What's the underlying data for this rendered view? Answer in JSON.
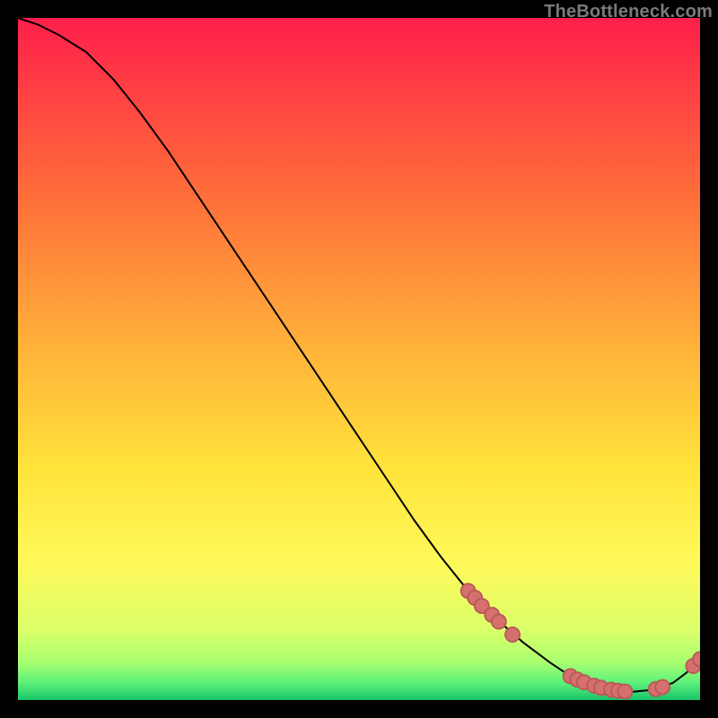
{
  "watermark": "TheBottleneck.com",
  "colors": {
    "frame": "#000000",
    "curve": "#000000",
    "marker_fill": "#d6706e",
    "marker_stroke": "#b85a57",
    "gradient_stops": [
      {
        "offset": 0.0,
        "color": "#ff1f4b"
      },
      {
        "offset": 0.25,
        "color": "#ff6b3a"
      },
      {
        "offset": 0.48,
        "color": "#ffb13a"
      },
      {
        "offset": 0.66,
        "color": "#ffe33a"
      },
      {
        "offset": 0.8,
        "color": "#fff95a"
      },
      {
        "offset": 0.9,
        "color": "#d9ff6a"
      },
      {
        "offset": 0.945,
        "color": "#a8ff70"
      },
      {
        "offset": 0.975,
        "color": "#5cf07a"
      },
      {
        "offset": 1.0,
        "color": "#17c46a"
      }
    ]
  },
  "chart_data": {
    "type": "line",
    "title": "",
    "xlabel": "",
    "ylabel": "",
    "xlim": [
      0,
      100
    ],
    "ylim": [
      0,
      100
    ],
    "series": [
      {
        "name": "curve",
        "x": [
          0,
          3,
          6,
          10,
          14,
          18,
          22,
          26,
          30,
          34,
          38,
          42,
          46,
          50,
          54,
          58,
          62,
          66,
          70,
          74,
          78,
          81,
          84,
          87,
          90,
          93,
          96,
          98,
          100
        ],
        "y": [
          100,
          99,
          97.5,
          95,
          91,
          86,
          80.5,
          74.5,
          68.5,
          62.5,
          56.5,
          50.5,
          44.5,
          38.5,
          32.5,
          26.5,
          21,
          16,
          12,
          8.5,
          5.5,
          3.5,
          2.2,
          1.5,
          1.2,
          1.5,
          2.5,
          4,
          6
        ]
      }
    ],
    "markers": [
      {
        "x": 66,
        "y": 16.0
      },
      {
        "x": 67,
        "y": 15.0
      },
      {
        "x": 68,
        "y": 13.8
      },
      {
        "x": 69.5,
        "y": 12.5
      },
      {
        "x": 70.5,
        "y": 11.5
      },
      {
        "x": 72.5,
        "y": 9.6
      },
      {
        "x": 81,
        "y": 3.5
      },
      {
        "x": 82,
        "y": 3.0
      },
      {
        "x": 83,
        "y": 2.6
      },
      {
        "x": 84.5,
        "y": 2.1
      },
      {
        "x": 85.5,
        "y": 1.8
      },
      {
        "x": 87,
        "y": 1.5
      },
      {
        "x": 88,
        "y": 1.35
      },
      {
        "x": 89,
        "y": 1.25
      },
      {
        "x": 93.5,
        "y": 1.6
      },
      {
        "x": 94.5,
        "y": 1.9
      },
      {
        "x": 99,
        "y": 5.0
      },
      {
        "x": 100,
        "y": 6.0
      }
    ]
  }
}
